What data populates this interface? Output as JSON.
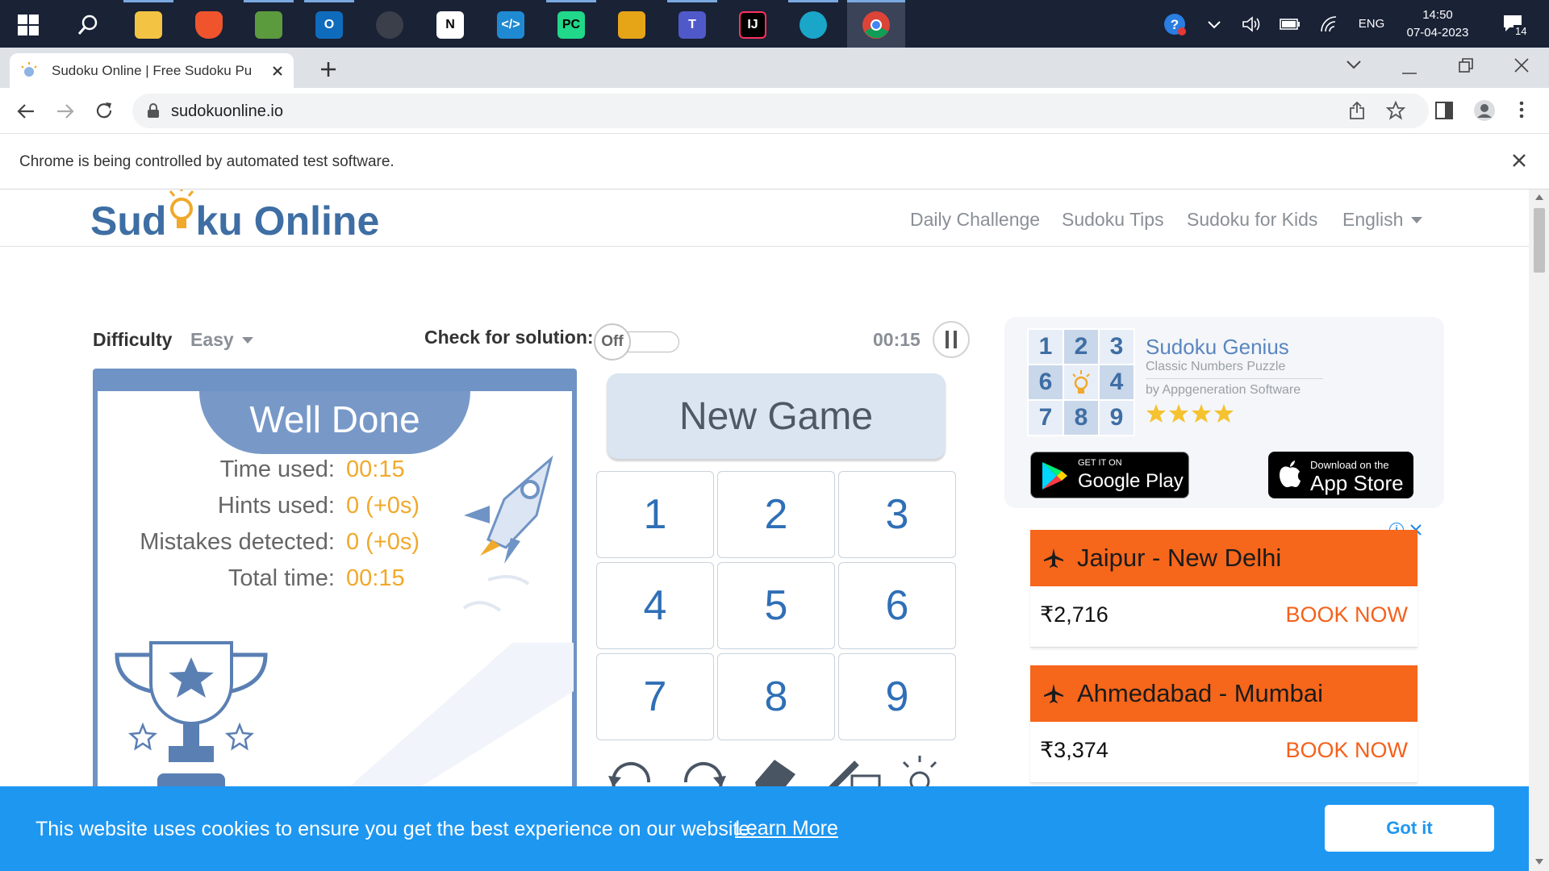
{
  "taskbar": {
    "apps": [
      "start",
      "search",
      "file-explorer",
      "brave",
      "notepad",
      "outlook",
      "dbeaver",
      "notion",
      "vscode",
      "pycharm",
      "yed",
      "teams",
      "intellij",
      "edge",
      "chrome"
    ],
    "tray_lang": "ENG",
    "time": "14:50",
    "date": "07-04-2023",
    "notification_count": "14"
  },
  "browser": {
    "tab_title": "Sudoku Online | Free Sudoku Pu",
    "url": "sudokuonline.io",
    "infobar_text": "Chrome is being controlled by automated test software."
  },
  "site": {
    "logo_part1": "Sud",
    "logo_part2": "ku Online",
    "nav": [
      "Daily Challenge",
      "Sudoku Tips",
      "Sudoku for Kids",
      "English"
    ]
  },
  "game": {
    "difficulty_label": "Difficulty",
    "difficulty_value": "Easy",
    "check_label": "Check for solution:",
    "toggle_state": "Off",
    "timer": "00:15",
    "new_game": "New Game",
    "keypad": [
      "1",
      "2",
      "3",
      "4",
      "5",
      "6",
      "7",
      "8",
      "9"
    ],
    "well_done": {
      "title": "Well Done",
      "rows": [
        {
          "label": "Time used:",
          "value": "00:15"
        },
        {
          "label": "Hints used:",
          "value": "0 (+0s)"
        },
        {
          "label": "Mistakes detected:",
          "value": "0 (+0s)"
        },
        {
          "label": "Total time:",
          "value": "00:15"
        }
      ]
    }
  },
  "promo": {
    "grid": [
      "1",
      "2",
      "3",
      "6",
      "",
      "4",
      "7",
      "8",
      "9"
    ],
    "title": "Sudoku Genius",
    "subtitle": "Classic Numbers Puzzle",
    "by": "by Appgeneration Software",
    "rating": 4,
    "gplay_small": "GET IT ON",
    "gplay_big": "Google Play",
    "appstore_small": "Download on the",
    "appstore_big": "App Store"
  },
  "ads": [
    {
      "route": "Jaipur - New Delhi",
      "price": "₹2,716",
      "cta": "BOOK NOW"
    },
    {
      "route": "Ahmedabad - Mumbai",
      "price": "₹3,374",
      "cta": "BOOK NOW"
    }
  ],
  "cookie": {
    "text": "This website uses cookies to ensure you get the best experience on our website.",
    "learn_more": "Learn More",
    "button": "Got it"
  },
  "colors": {
    "taskbar": "#1a2236",
    "accent_blue": "#2f6fb6",
    "orange": "#f6661b",
    "cookie_bar": "#1e97f1",
    "panel_blue": "#6f93c4"
  }
}
